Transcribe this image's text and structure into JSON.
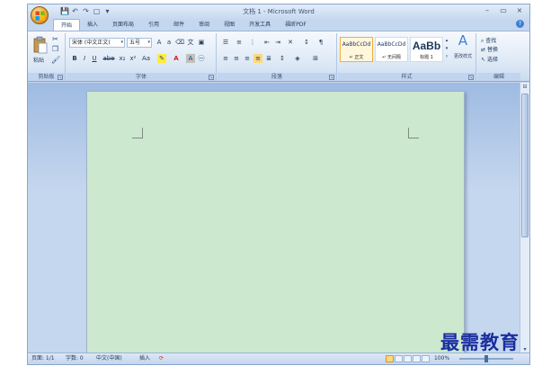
{
  "window": {
    "title": "文档 1 - Microsoft Word",
    "controls": {
      "minimize": "–",
      "maximize": "▭",
      "close": "×"
    }
  },
  "quick_access": {
    "save": "💾",
    "undo": "↶",
    "redo": "↷",
    "print_preview": "▢",
    "more": "▾"
  },
  "tabs": [
    "开始",
    "插入",
    "页面布局",
    "引用",
    "邮件",
    "审阅",
    "视图",
    "开发工具",
    "福昕PDF"
  ],
  "active_tab": "开始",
  "ribbon": {
    "clipboard": {
      "label": "剪贴板",
      "paste": "粘贴"
    },
    "font": {
      "label": "字体",
      "font_name": "宋体 (中文正文)",
      "font_size": "五号",
      "buttons": [
        "B",
        "I",
        "U",
        "abe",
        "x₂",
        "x²",
        "Aa"
      ]
    },
    "paragraph": {
      "label": "段落"
    },
    "styles": {
      "label": "样式",
      "items": [
        {
          "sample": "AaBbCcDd",
          "name": "↵ 正文",
          "selected": true
        },
        {
          "sample": "AaBbCcDd",
          "name": "↵ 无间隔",
          "selected": false
        },
        {
          "sample": "AaBb",
          "name": "标题 1",
          "selected": false
        }
      ],
      "change_styles": "更改样式"
    },
    "editing": {
      "label": "编辑",
      "find": "查找",
      "replace": "替换",
      "select": "选择"
    }
  },
  "statusbar": {
    "page": "页面: 1/1",
    "words": "字数: 0",
    "language": "中文(中国)",
    "insert_mode": "插入",
    "zoom": "100%"
  },
  "watermark": "最需教育",
  "colors": {
    "page_background": "#cce8cf",
    "frame": "#c5d7ee",
    "watermark": "#1b2fa0"
  }
}
